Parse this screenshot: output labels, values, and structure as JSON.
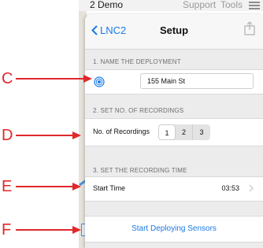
{
  "background": {
    "title": "2 Demo",
    "support": "Support",
    "tools": "Tools"
  },
  "nav": {
    "back_label": "LNC2",
    "title": "Setup"
  },
  "section1": {
    "header": "1. NAME THE DEPLOYMENT",
    "input_value": "155 Main St"
  },
  "section2": {
    "header": "2. SET NO. OF RECORDINGS",
    "label": "No. of Recordings",
    "options": [
      "1",
      "2",
      "3"
    ],
    "selected": "1"
  },
  "section3": {
    "header": "3. SET THE RECORDING TIME",
    "label": "Start Time",
    "value": "03:53"
  },
  "action": {
    "label": "Start Deploying Sensors"
  },
  "callouts": [
    "C",
    "D",
    "E",
    "F"
  ],
  "colors": {
    "accent": "#1a7ae6",
    "callout": "#e0282b",
    "group_bg": "#ececec"
  }
}
